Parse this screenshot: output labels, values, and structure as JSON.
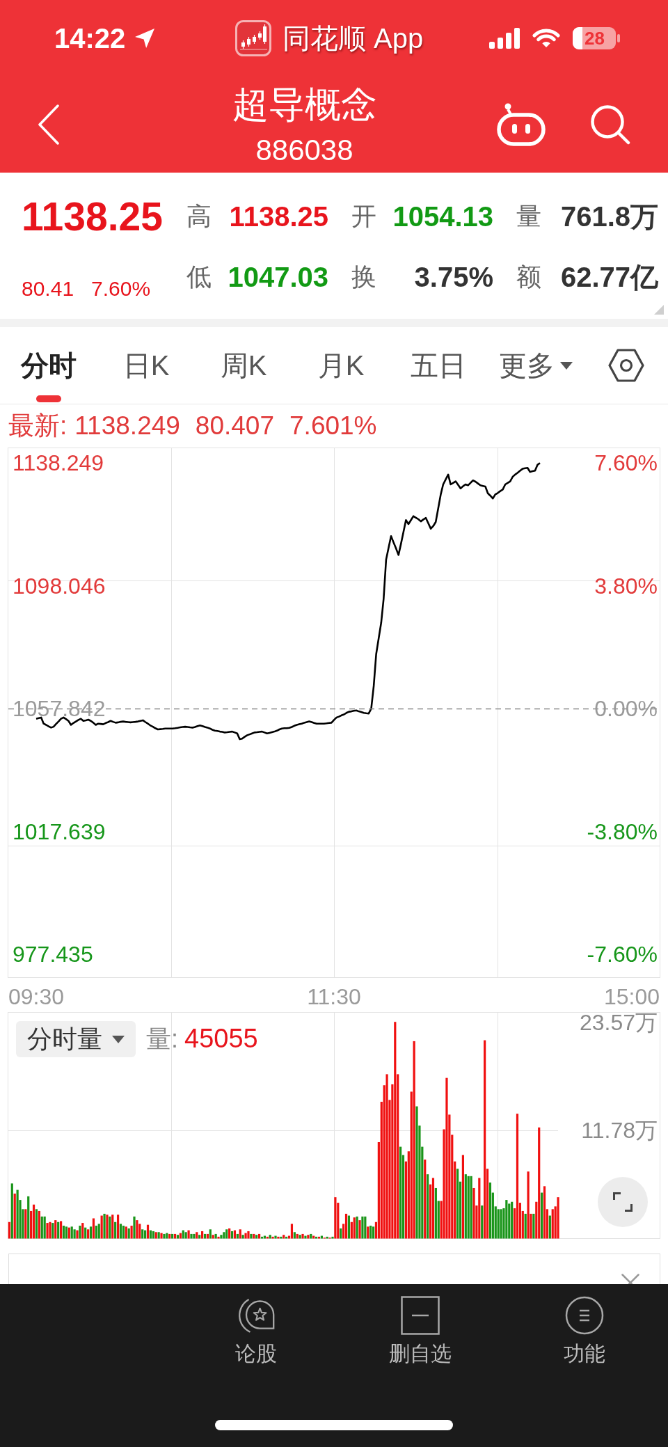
{
  "status_bar": {
    "time": "14:22",
    "back_app": "同花顺 App",
    "battery": "28"
  },
  "header": {
    "title": "超导概念",
    "code": "886038"
  },
  "quote": {
    "price": "1138.25",
    "change": "80.41",
    "change_percent": "7.60%",
    "stats": [
      {
        "label": "高",
        "value": "1138.25",
        "color": "#e8141c"
      },
      {
        "label": "开",
        "value": "1054.13",
        "color": "#129a14"
      },
      {
        "label": "量",
        "value": "761.8万",
        "color": "#333333"
      },
      {
        "label": "低",
        "value": "1047.03",
        "color": "#129a14"
      },
      {
        "label": "换",
        "value": "3.75%",
        "color": "#333333"
      },
      {
        "label": "额",
        "value": "62.77亿",
        "color": "#333333"
      }
    ]
  },
  "tabs": [
    {
      "label": "分时",
      "kind": "tab",
      "selected": true
    },
    {
      "label": "日K",
      "kind": "tab",
      "selected": false
    },
    {
      "label": "周K",
      "kind": "tab",
      "selected": false
    },
    {
      "label": "月K",
      "kind": "tab",
      "selected": false
    },
    {
      "label": "五日",
      "kind": "tab",
      "selected": false
    },
    {
      "label": "更多",
      "kind": "menu",
      "selected": false
    }
  ],
  "latest": {
    "label": "最新:",
    "values": [
      "1138.249",
      "80.407",
      "7.601%"
    ]
  },
  "price_chart": {
    "chart_data": {
      "type": "line",
      "categories": [
        "09:30",
        null,
        null,
        null,
        null,
        null,
        null,
        null,
        null,
        null,
        null,
        null,
        null,
        null,
        null,
        null,
        null,
        null,
        null,
        null,
        null,
        null,
        null,
        null,
        null,
        null,
        null,
        null,
        null,
        null,
        null,
        null,
        null,
        null,
        null,
        null,
        null,
        null,
        null,
        null,
        null,
        null,
        null,
        null,
        null,
        null,
        null,
        null,
        null,
        null,
        null,
        null,
        null,
        null,
        null,
        null,
        null,
        null,
        null,
        null,
        null,
        null,
        null,
        null,
        null,
        null,
        null,
        null,
        null,
        null,
        null,
        null,
        null,
        null,
        null,
        null,
        null,
        null,
        null,
        null,
        null,
        null,
        null,
        null,
        null,
        null,
        null,
        null,
        null,
        null,
        null,
        null,
        null,
        null,
        null,
        null,
        null,
        null,
        null,
        null,
        null,
        null,
        null,
        null,
        null,
        null,
        null,
        null,
        null,
        null,
        null,
        null,
        null,
        null,
        null,
        null,
        null,
        null,
        null,
        null,
        "11:30",
        null,
        null,
        null,
        null,
        null,
        null,
        null,
        null,
        null,
        null,
        null,
        null,
        null,
        null,
        null,
        null,
        null,
        null,
        null,
        null,
        null,
        null,
        null,
        null,
        null,
        null,
        null,
        null,
        null,
        null,
        null,
        null,
        null,
        null,
        null,
        null,
        null,
        null,
        null,
        null,
        null,
        null,
        null,
        null,
        null,
        null,
        null,
        null,
        null,
        null,
        null,
        null,
        null,
        null,
        null,
        null,
        null,
        null,
        null,
        null,
        null,
        null,
        null,
        null,
        null,
        null,
        null,
        null,
        null,
        null,
        null,
        null,
        null,
        null,
        null,
        null,
        null,
        null,
        null,
        null,
        null,
        null,
        null,
        null,
        null,
        null,
        null,
        null,
        null,
        null,
        null,
        null,
        null,
        null,
        null,
        null,
        null,
        null,
        null,
        null,
        null,
        null,
        null,
        null,
        null,
        null,
        null,
        null,
        null,
        null,
        null,
        null,
        null,
        null,
        null,
        null,
        null,
        null,
        null,
        "15:00"
      ],
      "series": [
        {
          "color": "#000000",
          "values": [
            1054.5,
            1054.7,
            1054.9,
            1052.9,
            1052.5,
            1052.0,
            1051.6,
            1051.9,
            1052.8,
            1053.6,
            1054.5,
            1054.9,
            1054.4,
            1053.8,
            1052.5,
            1053.1,
            1053.6,
            1054.1,
            1054.5,
            1053.8,
            1054.0,
            1054.2,
            1053.8,
            1053.2,
            1052.5,
            1052.9,
            1052.8,
            1052.7,
            1053.1,
            1053.4,
            1053.8,
            1053.5,
            1053.2,
            1053.3,
            1053.5,
            1053.6,
            1053.5,
            1053.4,
            1053.3,
            1053.4,
            1053.5,
            1053.6,
            1053.8,
            1054.0,
            1053.4,
            1052.9,
            1052.3,
            1051.9,
            1051.4,
            1051.0,
            1051.1,
            1051.2,
            1051.3,
            1051.3,
            1051.3,
            1051.3,
            1051.4,
            1051.5,
            1051.7,
            1051.8,
            1051.9,
            1051.8,
            1051.7,
            1051.6,
            1051.8,
            1052.1,
            1052.3,
            1052.1,
            1051.8,
            1051.6,
            1051.3,
            1050.9,
            1050.6,
            1050.5,
            1050.3,
            1050.2,
            1050.0,
            1050.1,
            1050.2,
            1050.3,
            1050.0,
            1049.7,
            1047.8,
            1048.0,
            1048.6,
            1049.1,
            1049.4,
            1049.7,
            1050.0,
            1050.1,
            1050.2,
            1050.3,
            1050.0,
            1049.7,
            1049.9,
            1050.1,
            1050.3,
            1050.6,
            1051.0,
            1051.3,
            1051.4,
            1051.4,
            1051.5,
            1051.8,
            1052.2,
            1052.5,
            1052.7,
            1052.9,
            1053.2,
            1053.4,
            1053.6,
            1053.4,
            1053.1,
            1052.9,
            1052.9,
            1052.9,
            1052.9,
            1053.0,
            1053.1,
            1053.2,
            1054.1,
            1054.9,
            1055.2,
            1055.6,
            1055.9,
            1056.4,
            1056.8,
            1056.9,
            1057.1,
            1057.2,
            1056.9,
            1056.7,
            1056.4,
            1056.3,
            1056.2,
            1057.8,
            1065.2,
            1075.6,
            1080.8,
            1085.9,
            1093.7,
            1106.6,
            1110.5,
            1114.3,
            1112.2,
            1110.2,
            1108.1,
            1111.8,
            1115.7,
            1119.5,
            1118.2,
            1119.5,
            1120.8,
            1120.3,
            1119.8,
            1119.1,
            1119.7,
            1120.2,
            1118.5,
            1116.7,
            1117.6,
            1118.9,
            1123.4,
            1127.9,
            1131.2,
            1132.8,
            1134.4,
            1131.2,
            1131.7,
            1132.2,
            1131.1,
            1129.9,
            1130.6,
            1131.2,
            1130.9,
            1131.7,
            1132.5,
            1132.1,
            1131.5,
            1130.9,
            1130.7,
            1130.5,
            1128.3,
            1127.5,
            1126.6,
            1127.9,
            1128.4,
            1129.0,
            1129.5,
            1131.2,
            1131.7,
            1132.2,
            1133.7,
            1134.4,
            1135.0,
            1135.7,
            1136.3,
            1136.5,
            1136.6,
            1135.3,
            1135.5,
            1135.7,
            1137.6,
            1138.2,
            null,
            null,
            null,
            null,
            null,
            null,
            null,
            null,
            null,
            null,
            null,
            null,
            null,
            null,
            null,
            null,
            null,
            null,
            null,
            null,
            null,
            null,
            null,
            null,
            null,
            null,
            null,
            null,
            null,
            null,
            null,
            null,
            null,
            null,
            null,
            null,
            null
          ]
        }
      ],
      "ylim": [
        969.8,
        1143.15
      ],
      "yticks": [
        {
          "value": 1138.249,
          "label": "1138.249"
        },
        {
          "value": 1098.046,
          "label": "1098.046"
        },
        {
          "value": 1057.842,
          "label": "1057.842"
        },
        {
          "value": 1017.639,
          "label": "1017.639"
        },
        {
          "value": 977.435,
          "label": "977.435"
        }
      ],
      "y2lim": [
        -8.32,
        8.06
      ],
      "y2ticks": [
        {
          "value": 7.6,
          "label": "7.60%"
        },
        {
          "value": 3.8,
          "label": "3.80%"
        },
        {
          "value": 0,
          "label": "0.00%"
        },
        {
          "value": -3.8,
          "label": "-3.80%"
        },
        {
          "value": -7.6,
          "label": "-7.60%"
        }
      ],
      "ref_lines": [
        {
          "axis": "y",
          "value": 1057.842
        }
      ]
    }
  },
  "volume_chart": {
    "selector": "分时量",
    "volume_label": "量:",
    "volume_value": "45055",
    "chart_data": {
      "type": "bar",
      "stacked": true,
      "ylim": [
        0,
        24.64
      ],
      "yticks": [
        {
          "value": 11.78,
          "label": "11.78万"
        },
        {
          "value": 23.57,
          "label": "23.57万"
        }
      ],
      "series": [
        {
          "color": "#f01010",
          "values": [
            1.8,
            null,
            4.9,
            null,
            null,
            null,
            3.2,
            null,
            3.0,
            3.7,
            null,
            3.0,
            null,
            null,
            1.7,
            1.8,
            null,
            2.0,
            null,
            1.9,
            null,
            null,
            1.2,
            null,
            null,
            0.9,
            null,
            1.7,
            null,
            1.0,
            null,
            2.2,
            null,
            null,
            2.5,
            null,
            2.6,
            null,
            2.6,
            null,
            2.6,
            null,
            null,
            1.3,
            null,
            1.4,
            null,
            2.0,
            1.6,
            null,
            null,
            1.5,
            null,
            null,
            0.7,
            null,
            0.6,
            null,
            null,
            0.5,
            null,
            0.5,
            null,
            0.6,
            null,
            null,
            0.9,
            null,
            null,
            0.7,
            null,
            0.8,
            null,
            0.5,
            null,
            0.4,
            null,
            0.2,
            null,
            null,
            null,
            1.1,
            null,
            0.9,
            null,
            1.0,
            null,
            0.6,
            0.8,
            null,
            0.5,
            null,
            0.5,
            null,
            null,
            0.2,
            null,
            0.2,
            null,
            0.2,
            null,
            0.4,
            null,
            0.3,
            1.6,
            null,
            0.5,
            null,
            0.5,
            null,
            0.4,
            null,
            0.3,
            null,
            0.2,
            null,
            0.1,
            null,
            0.1,
            null,
            4.5,
            3.9,
            null,
            1.6,
            2.7,
            null,
            1.8,
            2.3,
            null,
            2.0,
            null,
            null,
            1.3,
            null,
            null,
            1.8,
            10.5,
            14.9,
            16.7,
            17.9,
            15.1,
            16.8,
            23.6,
            17.9,
            null,
            null,
            8.4,
            9.5,
            16.0,
            21.5,
            null,
            null,
            null,
            8.6,
            null,
            5.9,
            6.6,
            null,
            null,
            4.1,
            11.9,
            17.5,
            13.5,
            11.3,
            8.4,
            null,
            null,
            9.1,
            null,
            null,
            null,
            5.5,
            3.6,
            6.6,
            null,
            21.6,
            7.6,
            null,
            null,
            null,
            null,
            null,
            null,
            null,
            null,
            null,
            3.3,
            13.6,
            3.9,
            3.0,
            null,
            7.3,
            2.7,
            null,
            4.0,
            12.1,
            null,
            5.7,
            3.2,
            null,
            3.2,
            3.5,
            4.5
          ]
        },
        {
          "color": "#1a951a",
          "values": [
            null,
            6.0,
            null,
            5.3,
            4.2,
            3.2,
            null,
            4.6,
            null,
            null,
            3.2,
            null,
            2.4,
            2.4,
            null,
            null,
            1.7,
            null,
            1.8,
            null,
            1.4,
            1.3,
            null,
            1.3,
            1.0,
            null,
            1.4,
            null,
            1.2,
            null,
            1.3,
            null,
            1.4,
            1.6,
            null,
            2.7,
            null,
            2.4,
            null,
            1.8,
            null,
            1.6,
            1.4,
            null,
            1.1,
            null,
            2.4,
            null,
            null,
            1.0,
            0.9,
            null,
            0.9,
            0.8,
            null,
            0.7,
            null,
            0.5,
            0.6,
            null,
            0.5,
            null,
            0.4,
            null,
            0.9,
            0.7,
            null,
            0.5,
            0.5,
            null,
            0.4,
            null,
            0.5,
            null,
            1.0,
            null,
            0.5,
            null,
            0.4,
            0.7,
            1.0,
            null,
            0.8,
            null,
            0.5,
            null,
            0.4,
            null,
            null,
            0.5,
            null,
            0.4,
            null,
            0.2,
            0.3,
            null,
            0.4,
            null,
            0.3,
            null,
            0.2,
            null,
            0.2,
            null,
            null,
            0.7,
            null,
            0.4,
            null,
            0.3,
            null,
            0.5,
            null,
            0.2,
            null,
            0.3,
            null,
            0.2,
            null,
            0.2,
            null,
            null,
            1.1,
            null,
            null,
            2.5,
            null,
            null,
            2.4,
            null,
            2.4,
            2.4,
            null,
            1.4,
            1.3,
            null,
            null,
            null,
            null,
            null,
            null,
            null,
            null,
            null,
            10.0,
            9.1,
            null,
            null,
            null,
            null,
            14.4,
            12.3,
            10.0,
            null,
            7.0,
            null,
            null,
            5.5,
            4.1,
            null,
            null,
            null,
            null,
            null,
            null,
            7.6,
            6.2,
            null,
            7.0,
            6.8,
            6.8,
            null,
            null,
            null,
            3.6,
            null,
            null,
            6.1,
            5.0,
            3.5,
            3.2,
            3.2,
            3.3,
            4.2,
            3.8,
            4.0,
            null,
            null,
            null,
            null,
            2.7,
            null,
            null,
            2.7,
            null,
            null,
            5.0,
            null,
            null,
            2.5,
            null,
            null,
            null
          ]
        }
      ]
    }
  },
  "bottom_bar": {
    "items": [
      {
        "label": "论股",
        "kind": "discuss"
      },
      {
        "label": "删自选",
        "kind": "remove"
      },
      {
        "label": "功能",
        "kind": "menu"
      }
    ]
  }
}
